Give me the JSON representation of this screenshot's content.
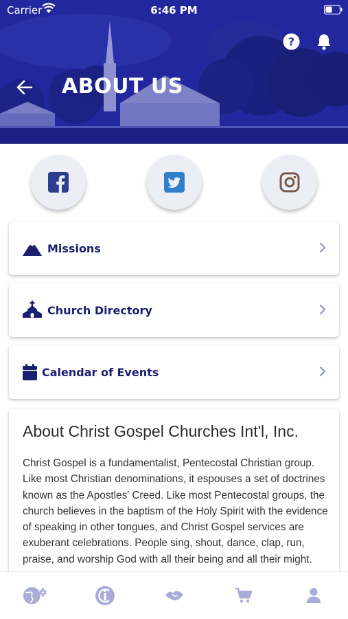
{
  "status_bar": {
    "carrier": "Carrier",
    "time": "6:46 PM"
  },
  "header": {
    "title": "ABOUT US"
  },
  "social": [
    {
      "icon": "facebook-icon",
      "color": "#2d3e8f"
    },
    {
      "icon": "twitter-icon",
      "color": "#2f80c8"
    },
    {
      "icon": "instagram-icon",
      "color": "#7a5a4a"
    }
  ],
  "menu": [
    {
      "label": "Missions",
      "icon": "mountain-icon"
    },
    {
      "label": "Church Directory",
      "icon": "church-icon"
    },
    {
      "label": "Calendar of Events",
      "icon": "calendar-icon"
    }
  ],
  "about": {
    "title": "About Christ Gospel Churches Int'l, Inc.",
    "body": "Christ Gospel is a fundamentalist, Pentecostal Christian group. Like most Christian denominations, it espouses a set of doctrines known as the Apostles' Creed. Like most Pentecostal groups, the church believes in the baptism of the Holy Spirit with the evidence of speaking in other tongues, and Christ Gospel services are exuberant celebrations. People sing, shout, dance, clap, run, praise, and worship God with all their being and all their might."
  },
  "tabbar": {
    "tabs": [
      {
        "icon": "globe-star-icon"
      },
      {
        "icon": "info-badge-icon"
      },
      {
        "icon": "handshake-icon"
      },
      {
        "icon": "cart-icon"
      },
      {
        "icon": "user-icon"
      }
    ]
  },
  "colors": {
    "header_blue": "#23289a",
    "menu_text": "#1a1f6e",
    "tab_icon": "#a9acd8"
  }
}
